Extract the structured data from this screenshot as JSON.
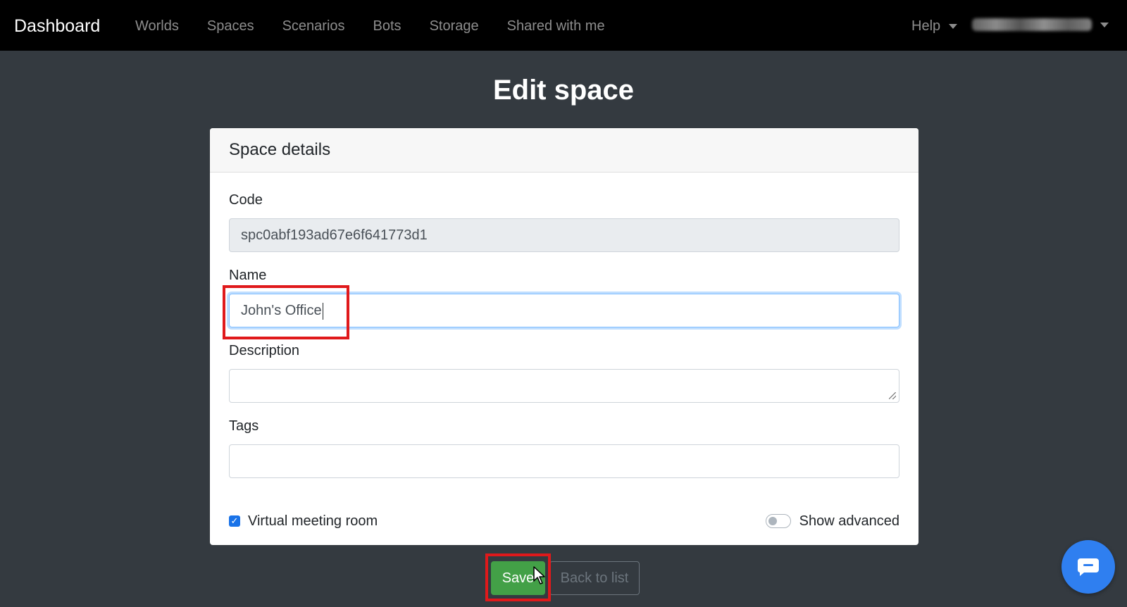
{
  "navbar": {
    "brand": "Dashboard",
    "links": [
      "Worlds",
      "Spaces",
      "Scenarios",
      "Bots",
      "Storage",
      "Shared with me"
    ],
    "help_label": "Help"
  },
  "page": {
    "title": "Edit space"
  },
  "card": {
    "header": "Space details",
    "code": {
      "label": "Code",
      "value": "spc0abf193ad67e6f641773d1"
    },
    "name": {
      "label": "Name",
      "value": "John's Office"
    },
    "description": {
      "label": "Description",
      "value": ""
    },
    "tags": {
      "label": "Tags",
      "value": ""
    },
    "virtual_meeting": {
      "label": "Virtual meeting room",
      "checked": true
    },
    "show_advanced": {
      "label": "Show advanced",
      "on": false
    }
  },
  "actions": {
    "save_label": "Save",
    "back_label": "Back to list"
  },
  "colors": {
    "save": "#43a047",
    "highlight": "#e0191b",
    "chat": "#2f7ff0",
    "navbar": "#000000"
  }
}
